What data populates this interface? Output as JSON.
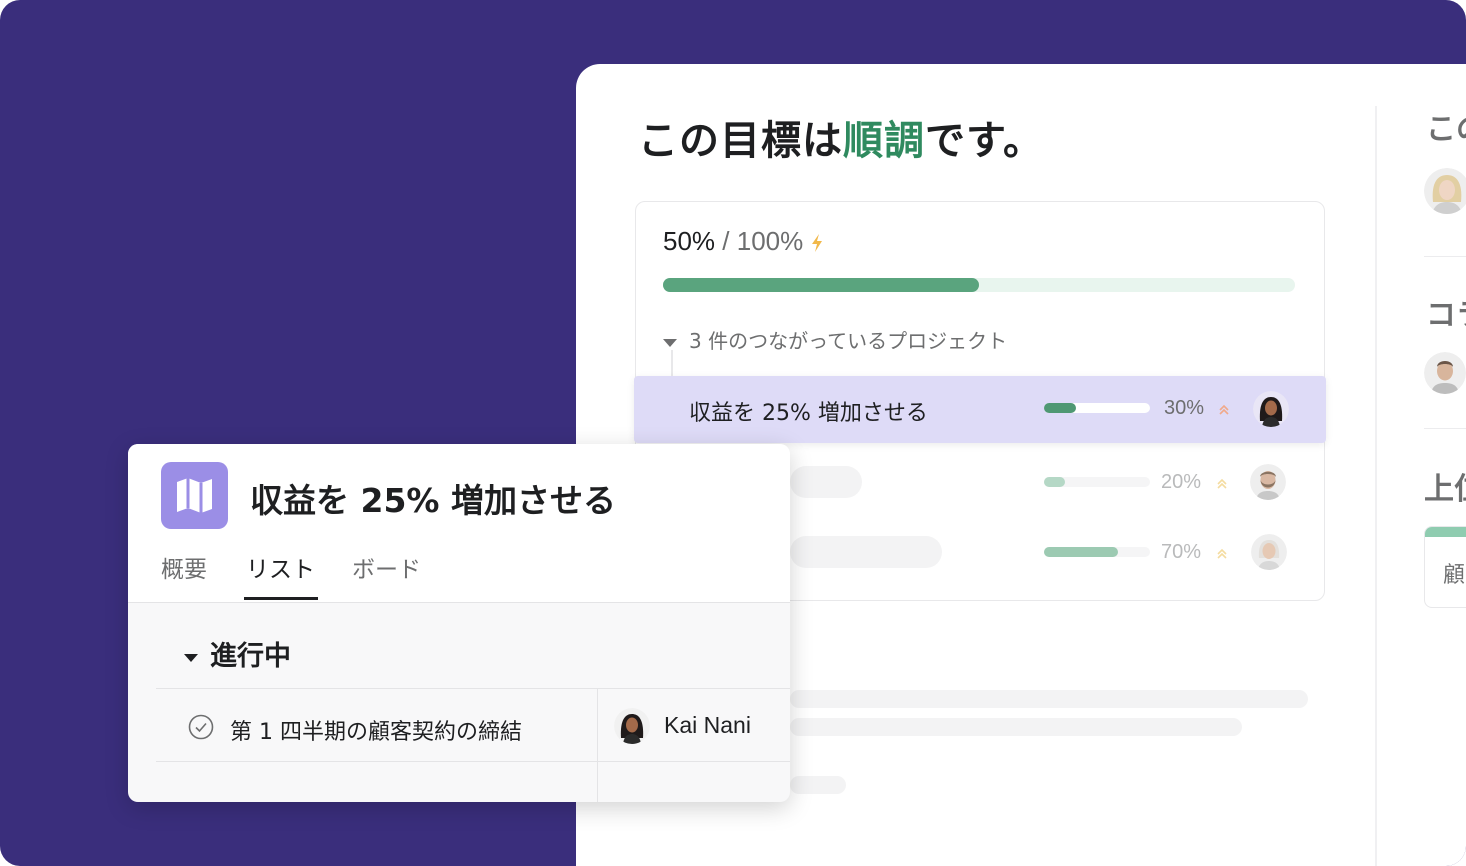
{
  "goal": {
    "title_prefix": "この目標は",
    "status_word": "順調",
    "title_suffix": "です。",
    "current_percent": "50%",
    "target_percent": "/ 100%",
    "progress": 0.5,
    "connected_projects_label": "3 件のつながっているプロジェクト"
  },
  "projects": [
    {
      "name": "収益を 25% 増加させる",
      "percent_label": "30%",
      "progress": 0.3,
      "avatar": "woman-dark-hair-avatar"
    },
    {
      "name": "",
      "percent_label": "20%",
      "progress": 0.2,
      "avatar": "bearded-man-avatar"
    },
    {
      "name": "",
      "percent_label": "70%",
      "progress": 0.7,
      "avatar": "older-woman-avatar"
    }
  ],
  "right_panel": {
    "heading1": "この",
    "heading2": "コラ",
    "heading3": "上位",
    "box_text": "顧"
  },
  "front_card": {
    "title": "収益を 25% 増加させる",
    "tabs": [
      {
        "label": "概要",
        "active": false
      },
      {
        "label": "リスト",
        "active": true
      },
      {
        "label": "ボード",
        "active": false
      }
    ],
    "section": "進行中",
    "task": {
      "name": "第 1 四半期の顧客契約の締結",
      "assignee": "Kai Nani"
    }
  },
  "colors": {
    "background": "#3a2e7c",
    "accent_green": "#2f8a5f",
    "progress_green": "#5aa47e",
    "highlight_row": "#dedbf7",
    "project_icon": "#9b8ee6"
  }
}
